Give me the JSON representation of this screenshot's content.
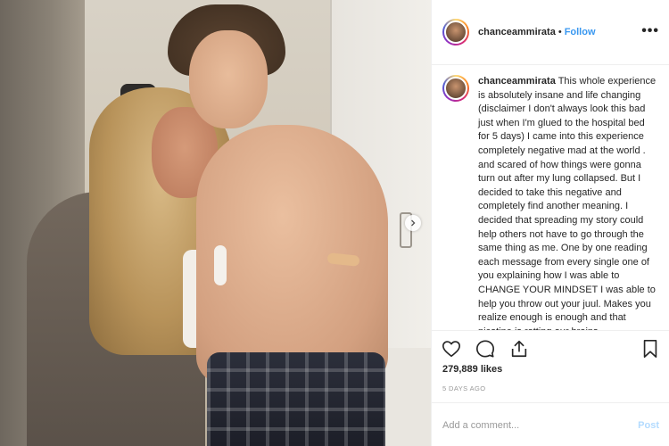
{
  "header": {
    "username": "chanceammirata",
    "separator": "•",
    "follow_label": "Follow",
    "more_label": "•••"
  },
  "caption": {
    "username": "chanceammirata",
    "text": "This whole experience is absolutely insane and life changing (disclaimer I don't always look this bad just when I'm glued to the hospital bed for 5 days) I came into this experience completely negative mad at the world . and scared of how things were gonna turn out after my lung collapsed. But I decided to take this negative and completely find another meaning. I decided that spreading my story could help others not have to go through the same thing as me. One by one reading each message from every single one of you explaining how I was able to CHANGE YOUR MINDSET I was able to help you throw out your juul. Makes you realize enough is enough and that nicotine is rotting our brains"
  },
  "actions": {
    "like_icon": "heart-icon",
    "comment_icon": "comment-icon",
    "share_icon": "share-icon",
    "save_icon": "bookmark-icon"
  },
  "likes": "279,889 likes",
  "date": "5 DAYS AGO",
  "comment": {
    "placeholder": "Add a comment...",
    "post_label": "Post"
  },
  "colors": {
    "link": "#3897f0",
    "post_disabled": "#b3dbff",
    "muted": "#999999"
  }
}
